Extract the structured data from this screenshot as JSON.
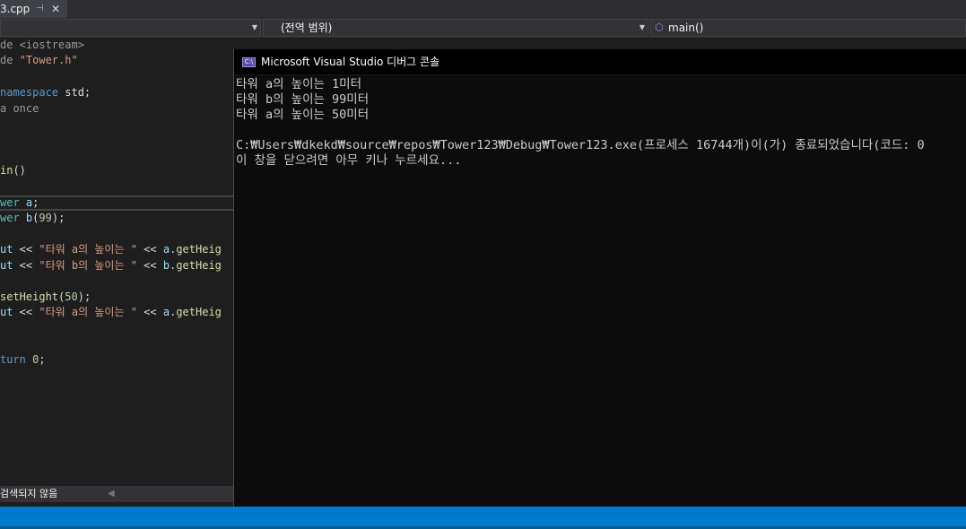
{
  "tab": {
    "filename": "3.cpp",
    "pin_glyph": "⊣",
    "close_glyph": "✕"
  },
  "navbar": {
    "scope_label": "(전역 범위)",
    "function_label": "main()",
    "dropdown_glyph": "▼",
    "function_icon": "⬡"
  },
  "editor": {
    "lines": [
      "de <iostream>",
      "de \"Tower.h\"",
      "",
      "namespace std;",
      "a once",
      "",
      "",
      "",
      "in()",
      "",
      "wer a;",
      "wer b(99);",
      "",
      "ut << \"타워 a의 높이는 \" << a.getHeig",
      "ut << \"타워 b의 높이는 \" << b.getHeig",
      "",
      "setHeight(50);",
      "ut << \"타워 a의 높이는 \" << a.getHeig",
      "",
      "",
      "turn 0;"
    ],
    "status_text": "검색되지 않음",
    "status_arrow": "◀"
  },
  "console": {
    "icon_text": "C:\\",
    "title": "Microsoft Visual Studio 디버그 콘솔",
    "lines": [
      "타워 a의 높이는 1미터",
      "타워 b의 높이는 99미터",
      "타워 a의 높이는 50미터",
      "",
      "C:₩Users₩dkekd₩source₩repos₩Tower123₩Debug₩Tower123.exe(프로세스 16744개)이(가) 종료되었습니다(코드: 0",
      "이 창을 닫으려면 아무 키나 누르세요..."
    ]
  },
  "colors": {
    "editor_bg": "#1e1e1e",
    "console_bg": "#0c0c0c",
    "status_blue": "#007acc"
  }
}
